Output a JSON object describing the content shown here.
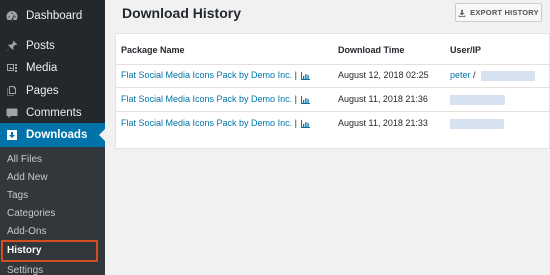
{
  "sidebar": {
    "items": [
      {
        "label": "Dashboard",
        "icon": "dashboard-icon"
      },
      {
        "label": "Posts",
        "icon": "pin-icon"
      },
      {
        "label": "Media",
        "icon": "media-icon"
      },
      {
        "label": "Pages",
        "icon": "pages-icon"
      },
      {
        "label": "Comments",
        "icon": "comments-icon"
      },
      {
        "label": "Downloads",
        "icon": "download-icon",
        "active": true
      }
    ],
    "submenu": [
      "All Files",
      "Add New",
      "Tags",
      "Categories",
      "Add-Ons",
      "History",
      "Settings"
    ],
    "current_submenu": "History",
    "accent_color": "#0073aa",
    "highlight_color": "#d54e21"
  },
  "main": {
    "title": "Download History",
    "export_label": "EXPORT HISTORY",
    "table": {
      "headers": [
        "Package Name",
        "Download Time",
        "User/IP"
      ],
      "rows": [
        {
          "package": "Flat Social Media Icons Pack by Demo Inc.",
          "separator": "|",
          "time": "August 12, 2018 02:25",
          "user": "peter",
          "user_sep": "/"
        },
        {
          "package": "Flat Social Media Icons Pack by Demo Inc.",
          "separator": "|",
          "time": "August 11, 2018 21:36",
          "user": "",
          "user_sep": ""
        },
        {
          "package": "Flat Social Media Icons Pack by Demo Inc.",
          "separator": "|",
          "time": "August 11, 2018 21:33",
          "user": "",
          "user_sep": ""
        }
      ]
    }
  }
}
